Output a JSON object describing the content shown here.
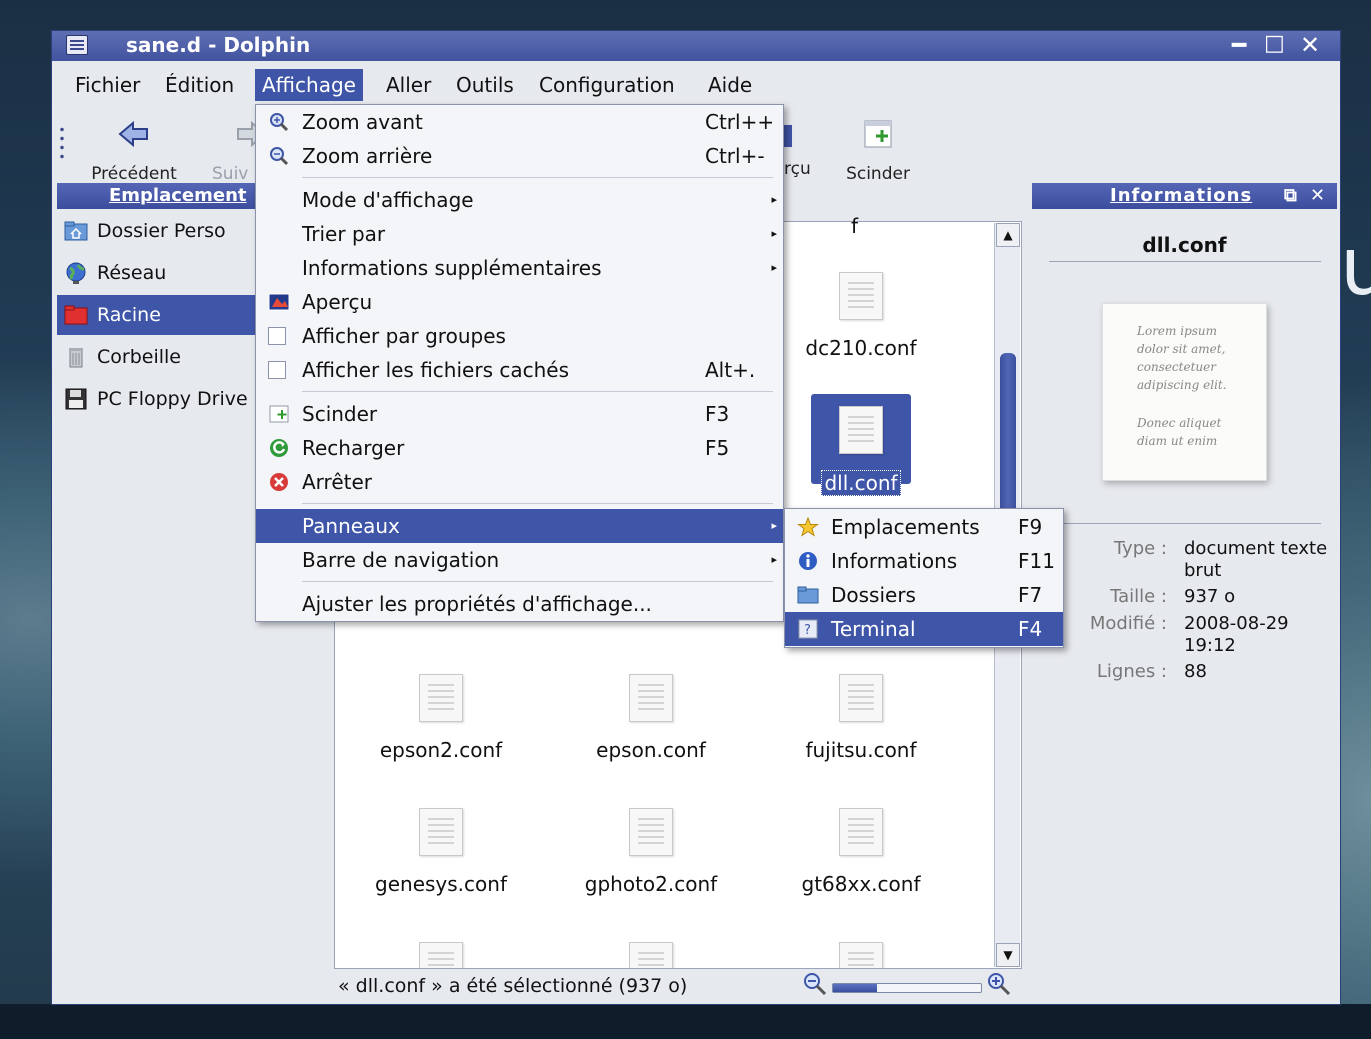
{
  "window": {
    "title": "sane.d - Dolphin",
    "controls": {
      "minimize": "━",
      "maximize": "□",
      "close": "✕"
    }
  },
  "menubar": [
    "Fichier",
    "Édition",
    "Affichage",
    "Aller",
    "Outils",
    "Configuration",
    "Aide"
  ],
  "toolbar": {
    "back_label": "Précédent",
    "forward_label": "Suiv",
    "preview_label": "rçu",
    "split_label": "Scinder"
  },
  "places": {
    "header": "Emplacement",
    "items": [
      {
        "label": "Dossier Perso",
        "icon": "home-folder-icon"
      },
      {
        "label": "Réseau",
        "icon": "network-globe-icon"
      },
      {
        "label": "Racine",
        "icon": "red-folder-icon"
      },
      {
        "label": "Corbeille",
        "icon": "trash-icon"
      },
      {
        "label": "PC Floppy Drive",
        "icon": "floppy-icon"
      }
    ]
  },
  "view_menu": {
    "items": [
      {
        "label": "Zoom avant",
        "shortcut": "Ctrl++",
        "icon": "zoom-in-icon"
      },
      {
        "label": "Zoom arrière",
        "shortcut": "Ctrl+-",
        "icon": "zoom-out-icon"
      },
      {
        "label": "Mode d'affichage"
      },
      {
        "label": "Trier par"
      },
      {
        "label": "Informations supplémentaires"
      },
      {
        "label": "Aperçu",
        "icon": "preview-icon"
      },
      {
        "label": "Afficher par groupes"
      },
      {
        "label": "Afficher les fichiers cachés",
        "shortcut": "Alt+."
      },
      {
        "label": "Scinder",
        "shortcut": "F3",
        "icon": "split-icon"
      },
      {
        "label": "Recharger",
        "shortcut": "F5",
        "icon": "reload-icon"
      },
      {
        "label": "Arrêter",
        "icon": "stop-icon"
      },
      {
        "label": "Panneaux"
      },
      {
        "label": "Barre de navigation"
      },
      {
        "label": "Ajuster les propriétés d'affichage..."
      }
    ]
  },
  "panels_menu": {
    "items": [
      {
        "label": "Emplacements",
        "shortcut": "F9",
        "icon": "star-icon"
      },
      {
        "label": "Informations",
        "shortcut": "F11",
        "icon": "info-icon"
      },
      {
        "label": "Dossiers",
        "shortcut": "F7",
        "icon": "folder-icon"
      },
      {
        "label": "Terminal",
        "shortcut": "F4",
        "icon": "terminal-icon"
      }
    ]
  },
  "files": {
    "partial_top": "f",
    "items": [
      "dc210.conf",
      "dll.conf",
      "epson2.conf",
      "epson.conf",
      "fujitsu.conf",
      "genesys.conf",
      "gphoto2.conf",
      "gt68xx.conf"
    ],
    "selected": "dll.conf"
  },
  "statusbar": {
    "text": "« dll.conf » a été sélectionné (937 o)",
    "zoom_level": 0.3
  },
  "info": {
    "header": "Informations",
    "filename": "dll.conf",
    "preview_lines": [
      "Lorem ipsum",
      "dolor sit amet,",
      "consectetuer",
      "adipiscing elit.",
      "",
      "Donec aliquet",
      "diam ut enim"
    ],
    "type_key": "Type :",
    "type_val": "document texte brut",
    "size_key": "Taille :",
    "size_val": "937 o",
    "modified_key": "Modifié :",
    "modified_val": "2008-08-29 19:12",
    "lines_key": "Lignes :",
    "lines_val": "88"
  },
  "colors": {
    "accent": "#3f55a8",
    "titlebar": "#4253a0",
    "window_bg": "#e6e9ee"
  }
}
